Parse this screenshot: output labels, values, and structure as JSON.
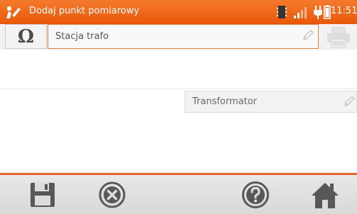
{
  "statusbar": {
    "title": "Dodaj punkt pomiarowy",
    "time": "11:51",
    "icons": [
      "app-logo-icon",
      "memory-card-icon",
      "signal-icon",
      "plug-icon",
      "battery-icon"
    ]
  },
  "row1": {
    "resistance_symbol": "Ω",
    "name_value": "Stacja trafo"
  },
  "type_field": {
    "value": "Transformator"
  },
  "toolbar": {
    "buttons": [
      "save-icon",
      "cancel-icon",
      "help-icon",
      "home-icon"
    ]
  },
  "colors": {
    "accent": "#e9580a",
    "toolbar": "#dcdcdc",
    "icon_gray": "#555555"
  }
}
